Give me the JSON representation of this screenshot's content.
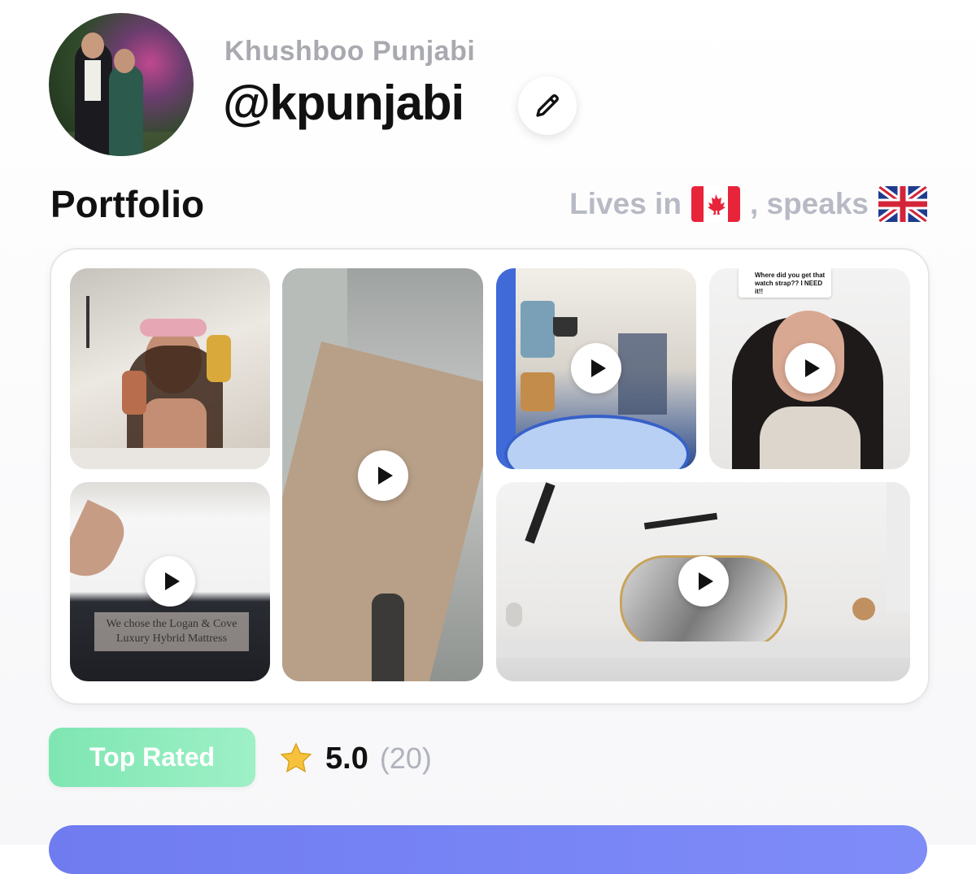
{
  "profile": {
    "display_name": "Khushboo Punjabi",
    "handle": "@kpunjabi",
    "edit_icon": "pencil-icon"
  },
  "portfolio": {
    "title": "Portfolio",
    "lives_in_label": "Lives in",
    "speaks_label": ", speaks",
    "country_flag": "canada-flag",
    "language_flag": "uk-flag",
    "tiles": [
      {
        "type": "image",
        "subject": "woman holding skincare bottles"
      },
      {
        "type": "video",
        "subject": "cardboard box close-up"
      },
      {
        "type": "video",
        "subject": "kitchen cabinet view"
      },
      {
        "type": "video",
        "subject": "woman reacting to comment",
        "overlay_text": "Where did you get that watch strap?? I NEED it!!"
      },
      {
        "type": "video",
        "subject": "mattress",
        "overlay_text": "We chose the Logan & Cove Luxury Hybrid Mattress"
      },
      {
        "type": "video",
        "subject": "marble vanity tray"
      }
    ]
  },
  "badge": {
    "label": "Top Rated",
    "color": "#86e9b8"
  },
  "rating": {
    "value": "5.0",
    "count": "(20)",
    "icon": "star-icon"
  },
  "colors": {
    "accent": "#7581f3",
    "text_muted": "#a9aab0"
  }
}
